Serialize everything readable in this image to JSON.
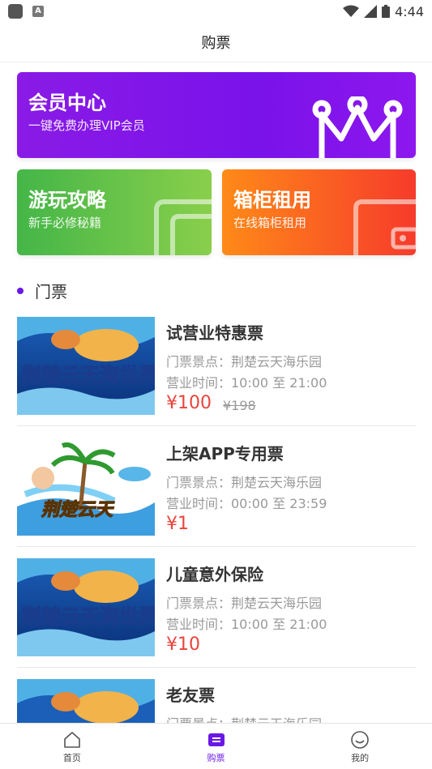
{
  "status_bar": {
    "time": "4:44"
  },
  "header": {
    "title": "购票"
  },
  "cards": {
    "vip": {
      "title": "会员中心",
      "subtitle": "一键免费办理VIP会员"
    },
    "guide": {
      "title": "游玩攻略",
      "subtitle": "新手必修秘籍"
    },
    "locker": {
      "title": "箱柜租用",
      "subtitle": "在线箱柜租用"
    }
  },
  "section": {
    "title": "门票"
  },
  "tickets": [
    {
      "name": "试营业特惠票",
      "spot": "门票景点：荆楚云天海乐园",
      "hours": "营业时间：10:00 至 21:00",
      "price": "¥100",
      "original": "¥198",
      "thumb_text": "荆楚云天海世界"
    },
    {
      "name": "上架APP专用票",
      "spot": "门票景点：荆楚云天海乐园",
      "hours": "营业时间：00:00 至 23:59",
      "price": "¥1",
      "original": "",
      "thumb_text": "荆楚云天"
    },
    {
      "name": "儿童意外保险",
      "spot": "门票景点：荆楚云天海乐园",
      "hours": "营业时间：10:00 至 21:00",
      "price": "¥10",
      "original": "",
      "thumb_text": "荆楚云天海世界"
    },
    {
      "name": "老友票",
      "spot": "门票景点：荆楚云天海乐园",
      "hours": "",
      "price": "",
      "original": "",
      "thumb_text": ""
    }
  ],
  "tabbar": {
    "home": "首页",
    "tickets": "购票",
    "mine": "我的"
  },
  "colors": {
    "accent": "#6a18e6",
    "price": "#e8453c"
  }
}
